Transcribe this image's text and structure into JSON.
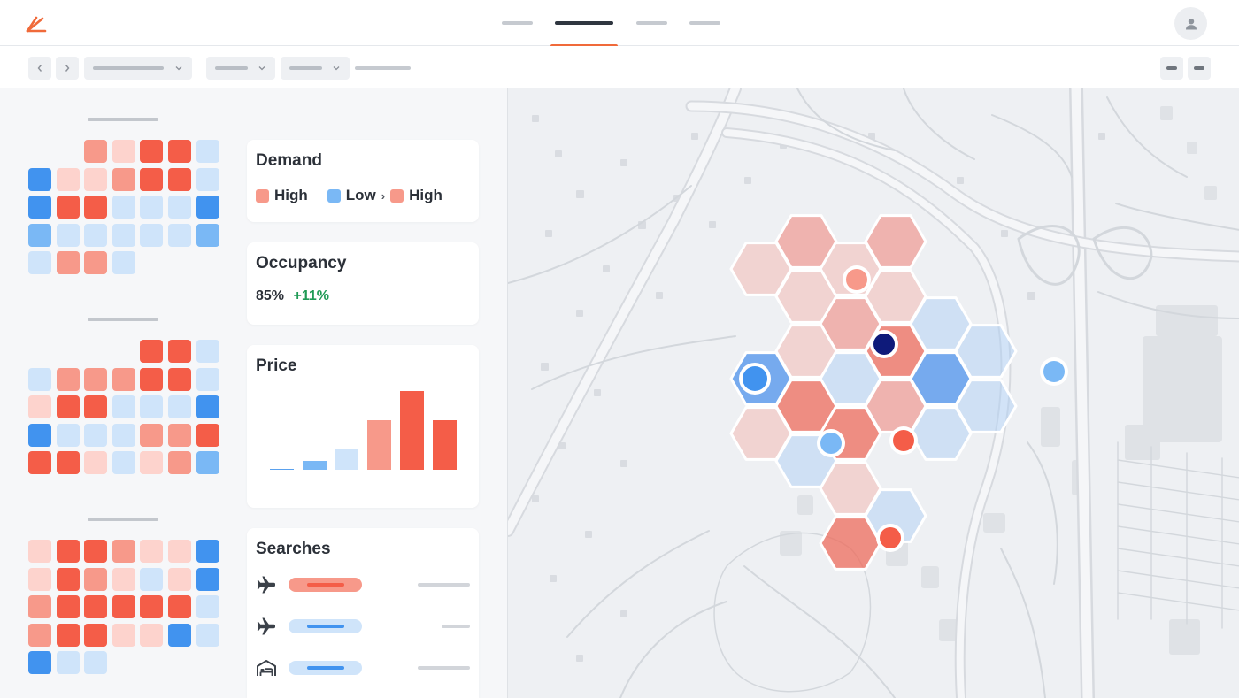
{
  "app": {
    "logo_icon": "app-logo-icon",
    "accent_color": "#f06a3a",
    "avatar_icon": "user-icon"
  },
  "panels": {
    "demand": {
      "title": "Demand",
      "legend": [
        {
          "label": "High",
          "color": "#f7998a"
        },
        {
          "label": "Low",
          "color": "#7ab8f5"
        },
        {
          "label": "High",
          "color": "#f7998a"
        }
      ],
      "legend_arrow": "›"
    },
    "occupancy": {
      "title": "Occupancy",
      "value": "85%",
      "change": "+11%"
    },
    "price": {
      "title": "Price",
      "bars": [
        {
          "value": 1,
          "color": "#5aa1ee"
        },
        {
          "value": 9,
          "color": "#7ab8f5"
        },
        {
          "value": 22,
          "color": "#cfe4fa"
        },
        {
          "value": 50,
          "color": "#f7998a"
        },
        {
          "value": 80,
          "color": "#f45d48"
        },
        {
          "value": 50,
          "color": "#f45d48"
        }
      ]
    },
    "searches": {
      "title": "Searches",
      "rows": [
        {
          "icon": "airplane-icon",
          "tone": "red"
        },
        {
          "icon": "airplane-icon",
          "tone": "blue"
        },
        {
          "icon": "hotel-bed-icon",
          "tone": "blue"
        }
      ]
    }
  },
  "colors": {
    "red_strong": "#f45d48",
    "red_mid": "#f7998a",
    "red_light": "#fdd3cd",
    "blue_strong": "#4193ef",
    "blue_mid": "#7ab8f5",
    "blue_light": "#cfe4fa",
    "positive": "#1f9a55",
    "marker_dark": "#0e1a7a"
  },
  "heat_grids": [
    {
      "rows": [
        [
          "",
          "",
          "rm",
          "rl",
          "rs",
          "rs",
          "bl"
        ],
        [
          "bs",
          "rl",
          "rl",
          "rm",
          "rs",
          "rs",
          "bl"
        ],
        [
          "bs",
          "rs",
          "rs",
          "bl",
          "bl",
          "bl",
          "bs"
        ],
        [
          "bm",
          "bl",
          "bl",
          "bl",
          "bl",
          "bl",
          "bm"
        ],
        [
          "bl",
          "rm",
          "rm",
          "bl",
          "",
          "",
          ""
        ]
      ]
    },
    {
      "rows": [
        [
          "",
          "",
          "",
          "",
          "rs",
          "rs",
          "bl"
        ],
        [
          "bl",
          "rm",
          "rm",
          "rm",
          "rs",
          "rs",
          "bl"
        ],
        [
          "rl",
          "rs",
          "rs",
          "bl",
          "bl",
          "bl",
          "bs"
        ],
        [
          "bs",
          "bl",
          "bl",
          "bl",
          "rm",
          "rm",
          "rs"
        ],
        [
          "rs",
          "rs",
          "rl",
          "bl",
          "rl",
          "rm",
          "bm"
        ]
      ]
    },
    {
      "rows": [
        [
          "rl",
          "rs",
          "rs",
          "rm",
          "rl",
          "rl",
          "bs"
        ],
        [
          "rl",
          "rs",
          "rm",
          "rl",
          "bl",
          "rl",
          "bs"
        ],
        [
          "rm",
          "rs",
          "rs",
          "rs",
          "rs",
          "rs",
          "bl"
        ],
        [
          "rm",
          "rs",
          "rs",
          "rl",
          "rl",
          "bs",
          "bl"
        ],
        [
          "bs",
          "bl",
          "bl",
          "",
          "",
          "",
          ""
        ]
      ]
    }
  ],
  "map": {
    "hexes": [
      [
        "rm",
        910,
        273
      ],
      [
        "rm",
        1011,
        273
      ],
      [
        "rl",
        859,
        304
      ],
      [
        "rl",
        960,
        304
      ],
      [
        "rl",
        910,
        335
      ],
      [
        "rl",
        1011,
        335
      ],
      [
        "bl",
        1062,
        366
      ],
      [
        "rm",
        960,
        366
      ],
      [
        "rl",
        910,
        397
      ],
      [
        "rs",
        1011,
        397
      ],
      [
        "bl",
        1113,
        397
      ],
      [
        "bs",
        859,
        428
      ],
      [
        "bl",
        960,
        428
      ],
      [
        "bs",
        1062,
        428
      ],
      [
        "rs",
        910,
        459
      ],
      [
        "rm",
        1011,
        459
      ],
      [
        "bl",
        1113,
        459
      ],
      [
        "rl",
        859,
        490
      ],
      [
        "rs",
        960,
        490
      ],
      [
        "bl",
        1062,
        490
      ],
      [
        "bl",
        910,
        521
      ],
      [
        "rl",
        960,
        552
      ],
      [
        "bl",
        1011,
        583
      ],
      [
        "rs",
        960,
        614
      ]
    ],
    "markers": [
      {
        "name": "marker-red",
        "color": "#f7998a",
        "r": 12
      },
      {
        "name": "marker-dark",
        "color": "#0e1a7a",
        "r": 12
      },
      {
        "name": "marker-blue-large",
        "color": "#4193ef",
        "r": 14
      },
      {
        "name": "marker-blue",
        "color": "#7ab8f5",
        "r": 12
      },
      {
        "name": "marker-red",
        "color": "#f45d48",
        "r": 12
      },
      {
        "name": "marker-red",
        "color": "#f45d48",
        "r": 12
      },
      {
        "name": "marker-blue",
        "color": "#7ab8f5",
        "r": 12
      }
    ]
  }
}
